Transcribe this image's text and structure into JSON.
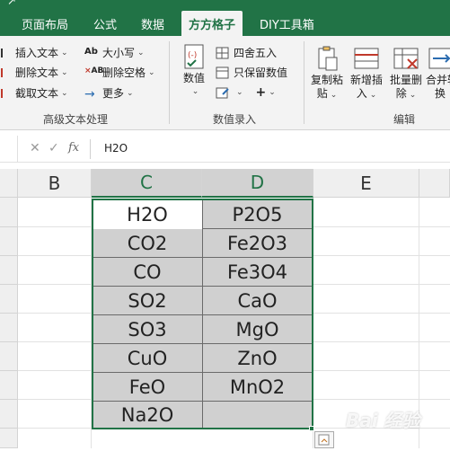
{
  "tabs": [
    "页面布局",
    "公式",
    "数据",
    "方方格子",
    "DIY工具箱"
  ],
  "active_tab_index": 3,
  "ribbon": {
    "text_group": {
      "label": "高级文本处理",
      "items": [
        "插入文本",
        "删除文本",
        "截取文本"
      ],
      "items2": [
        "大小写",
        "删除空格",
        "更多"
      ]
    },
    "number_group": {
      "label": "数值录入",
      "numeric_button": "数值",
      "round_label": "四舍五入",
      "keep_value_label": "只保留数值"
    },
    "edit_group": {
      "label": "编辑",
      "buttons": [
        [
          "复制粘",
          "贴"
        ],
        [
          "新增插",
          "入"
        ],
        [
          "批量删",
          "除"
        ],
        [
          "合并转",
          "换"
        ]
      ]
    }
  },
  "formula_bar": {
    "content": "H2O"
  },
  "columns": [
    "B",
    "C",
    "D",
    "E"
  ],
  "table": {
    "col_c": [
      "H2O",
      "CO2",
      "CO",
      "SO2",
      "SO3",
      "CuO",
      "FeO",
      "Na2O"
    ],
    "col_d": [
      "P2O5",
      "Fe2O3",
      "Fe3O4",
      "CaO",
      "MgO",
      "ZnO",
      "MnO2",
      ""
    ]
  },
  "colors": {
    "excel_green": "#217346",
    "cell_grey": "#d0d0d0"
  },
  "watermark": "Bai 经验"
}
